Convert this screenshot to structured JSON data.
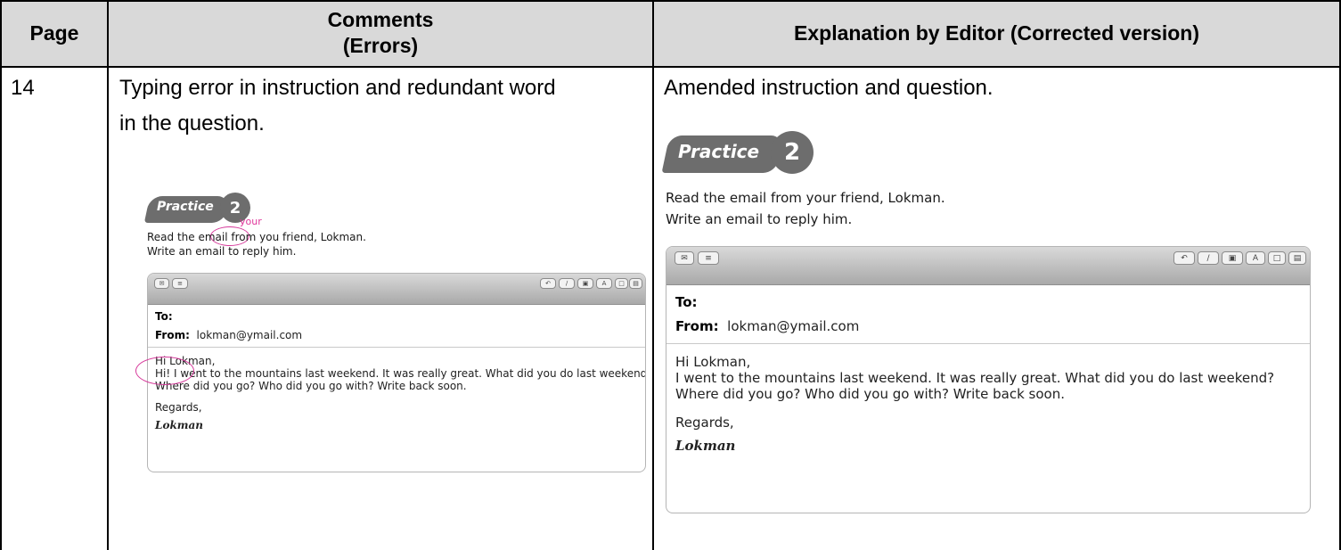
{
  "table": {
    "headers": {
      "page": "Page",
      "comments_line1": "Comments",
      "comments_line2": "(Errors)",
      "explanation": "Explanation by Editor (Corrected version)"
    },
    "row": {
      "page": "14",
      "comment_line1": "Typing error in instruction and redundant word",
      "comment_line2": "in the question.",
      "explanation": "Amended instruction and question."
    }
  },
  "practice": {
    "word": "Practice",
    "number": "2"
  },
  "original": {
    "annotation": "your",
    "instruction_part1": "Read the email from ",
    "instruction_wrong_word": "you",
    "instruction_part2": " friend, Lokman.",
    "instruction_line2": "Write an email to reply him.",
    "to_label": "To:",
    "from_label": "From:",
    "from_value": "lokman@ymail.com",
    "greeting": "Hi Lokman,",
    "redundant_word": "Hi!",
    "body_line1_rest": " I went to the mountains last weekend. It was really great. What did you do last weekend?",
    "body_line2": "Where did you go? Who did you go with? Write back soon.",
    "regards": "Regards,",
    "signature": "Lokman"
  },
  "corrected": {
    "instruction_line1": "Read the email from your friend, Lokman.",
    "instruction_line2": "Write an email to reply him.",
    "to_label": "To:",
    "from_label": "From:",
    "from_value": "lokman@ymail.com",
    "greeting": "Hi Lokman,",
    "body_line1": "I went to the mountains last weekend. It was really great. What did you do last weekend?",
    "body_line2": "Where did you go? Who did you go with? Write back soon.",
    "regards": "Regards,",
    "signature": "Lokman"
  },
  "toolbar_icons": [
    "send-icon",
    "list-icon",
    "reply-icon",
    "attach-icon",
    "photo-icon",
    "font-icon",
    "window-icon",
    "note-icon"
  ],
  "toolbar_font_glyph": "A",
  "colors": {
    "header_bg": "#d9d9d9",
    "annotation": "#e0359a",
    "badge": "#6d6d6d"
  }
}
